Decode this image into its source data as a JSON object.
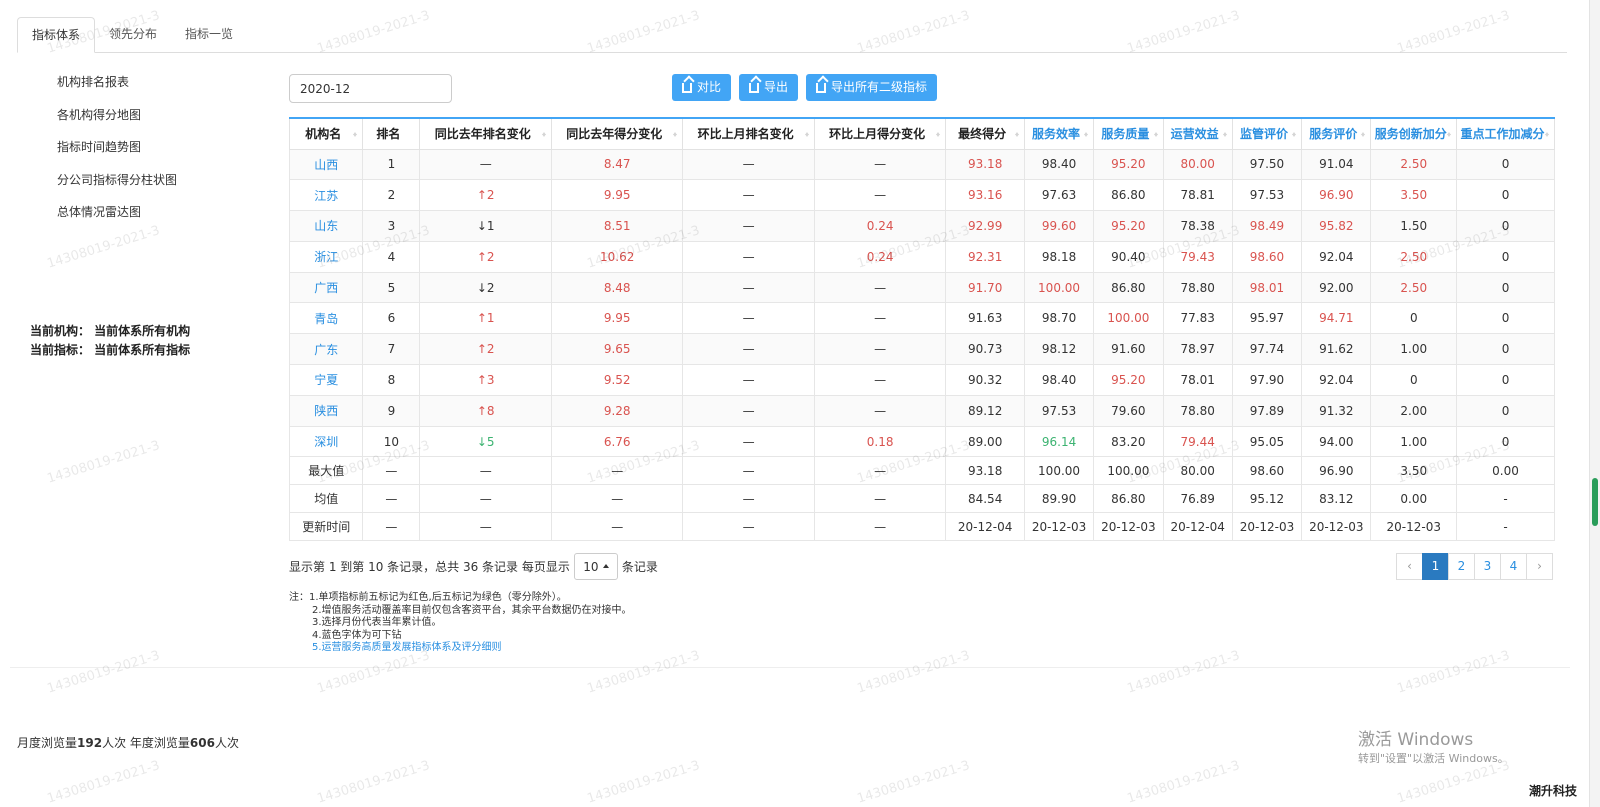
{
  "tabs": [
    {
      "label": "指标体系",
      "active": true
    },
    {
      "label": "领先分布",
      "active": false
    },
    {
      "label": "指标一览",
      "active": false
    }
  ],
  "sidebar": {
    "items": [
      {
        "label": "机构排名报表"
      },
      {
        "label": "各机构得分地图"
      },
      {
        "label": "指标时间趋势图"
      },
      {
        "label": "分公司指标得分柱状图"
      },
      {
        "label": "总体情况雷达图"
      }
    ],
    "current_org": "当前机构： 当前体系所有机构",
    "current_indicator": "当前指标： 当前体系所有指标"
  },
  "filter": {
    "date_value": "2020-12"
  },
  "toolbar": {
    "compare_label": "对比",
    "export_label": "导出",
    "export_all_label": "导出所有二级指标",
    "accent_color": "#42a5f5"
  },
  "table": {
    "columns": [
      "机构名",
      "排名",
      "同比去年排名变化",
      "同比去年得分变化",
      "环比上月排名变化",
      "环比上月得分变化",
      "最终得分",
      "服务效率",
      "服务质量",
      "运营效益",
      "监管评价",
      "服务评价",
      "服务创新加分",
      "重点工作加减分"
    ],
    "rows": [
      {
        "org": "山西",
        "rank": "1",
        "yoy_rank": "—",
        "yoy_score": "8.47",
        "mom_rank": "—",
        "mom_score": "—",
        "final": "93.18",
        "efficiency": "98.40",
        "quality": "95.20",
        "operation": "80.00",
        "regulation": "97.50",
        "service": "91.04",
        "innovation": "2.50",
        "key_work": "0"
      },
      {
        "org": "江苏",
        "rank": "2",
        "yoy_rank": "↑2",
        "yoy_score": "9.95",
        "mom_rank": "—",
        "mom_score": "—",
        "final": "93.16",
        "efficiency": "97.63",
        "quality": "86.80",
        "operation": "78.81",
        "regulation": "97.53",
        "service": "96.90",
        "innovation": "3.50",
        "key_work": "0"
      },
      {
        "org": "山东",
        "rank": "3",
        "yoy_rank": "↓1",
        "yoy_score": "8.51",
        "mom_rank": "—",
        "mom_score": "0.24",
        "final": "92.99",
        "efficiency": "99.60",
        "quality": "95.20",
        "operation": "78.38",
        "regulation": "98.49",
        "service": "95.82",
        "innovation": "1.50",
        "key_work": "0"
      },
      {
        "org": "浙江",
        "rank": "4",
        "yoy_rank": "↑2",
        "yoy_score": "10.62",
        "mom_rank": "—",
        "mom_score": "0.24",
        "final": "92.31",
        "efficiency": "98.18",
        "quality": "90.40",
        "operation": "79.43",
        "regulation": "98.60",
        "service": "92.04",
        "innovation": "2.50",
        "key_work": "0"
      },
      {
        "org": "广西",
        "rank": "5",
        "yoy_rank": "↓2",
        "yoy_score": "8.48",
        "mom_rank": "—",
        "mom_score": "—",
        "final": "91.70",
        "efficiency": "100.00",
        "quality": "86.80",
        "operation": "78.80",
        "regulation": "98.01",
        "service": "92.00",
        "innovation": "2.50",
        "key_work": "0"
      },
      {
        "org": "青岛",
        "rank": "6",
        "yoy_rank": "↑1",
        "yoy_score": "9.95",
        "mom_rank": "—",
        "mom_score": "—",
        "final": "91.63",
        "efficiency": "98.70",
        "quality": "100.00",
        "operation": "77.83",
        "regulation": "95.97",
        "service": "94.71",
        "innovation": "0",
        "key_work": "0"
      },
      {
        "org": "广东",
        "rank": "7",
        "yoy_rank": "↑2",
        "yoy_score": "9.65",
        "mom_rank": "—",
        "mom_score": "—",
        "final": "90.73",
        "efficiency": "98.12",
        "quality": "91.60",
        "operation": "78.97",
        "regulation": "97.74",
        "service": "91.62",
        "innovation": "1.00",
        "key_work": "0"
      },
      {
        "org": "宁夏",
        "rank": "8",
        "yoy_rank": "↑3",
        "yoy_score": "9.52",
        "mom_rank": "—",
        "mom_score": "—",
        "final": "90.32",
        "efficiency": "98.40",
        "quality": "95.20",
        "operation": "78.01",
        "regulation": "97.90",
        "service": "92.04",
        "innovation": "0",
        "key_work": "0"
      },
      {
        "org": "陕西",
        "rank": "9",
        "yoy_rank": "↑8",
        "yoy_score": "9.28",
        "mom_rank": "—",
        "mom_score": "—",
        "final": "89.12",
        "efficiency": "97.53",
        "quality": "79.60",
        "operation": "78.80",
        "regulation": "97.89",
        "service": "91.32",
        "innovation": "2.00",
        "key_work": "0"
      },
      {
        "org": "深圳",
        "rank": "10",
        "yoy_rank": "↓5",
        "yoy_score": "6.76",
        "mom_rank": "—",
        "mom_score": "0.18",
        "final": "89.00",
        "efficiency": "96.14",
        "quality": "83.20",
        "operation": "79.44",
        "regulation": "95.05",
        "service": "94.00",
        "innovation": "1.00",
        "key_work": "0"
      }
    ],
    "summary_rows": [
      {
        "label": "最大值",
        "cells": [
          "—",
          "—",
          "—",
          "—",
          "—",
          "93.18",
          "100.00",
          "100.00",
          "80.00",
          "98.60",
          "96.90",
          "3.50",
          "0.00"
        ]
      },
      {
        "label": "均值",
        "cells": [
          "—",
          "—",
          "—",
          "—",
          "—",
          "84.54",
          "89.90",
          "86.80",
          "76.89",
          "95.12",
          "83.12",
          "0.00",
          "-"
        ]
      },
      {
        "label": "更新时间",
        "cells": [
          "—",
          "—",
          "—",
          "—",
          "—",
          "20-12-04",
          "20-12-03",
          "20-12-03",
          "20-12-04",
          "20-12-03",
          "20-12-03",
          "20-12-03",
          "-"
        ]
      }
    ],
    "highlight_colors": {
      "top_five": "#d9534f",
      "bottom_five": "#3cb371",
      "drilldown": "#2a8fe0"
    }
  },
  "pager": {
    "info_prefix": "显示第 1 到第 10 条记录，总共 36 条记录  每页显示",
    "page_size": "10",
    "info_suffix": "条记录",
    "prev": "‹",
    "pages": [
      "1",
      "2",
      "3",
      "4"
    ],
    "next": "›",
    "current_page": "1"
  },
  "notes": {
    "first": "注：1.单项指标前五标记为红色,后五标记为绿色（零分除外）。",
    "items": [
      "2.增值服务活动覆盖率目前仅包含客资平台，其余平台数据仍在对接中。",
      "3.选择月份代表当年累计值。",
      "4.蓝色字体为可下钻"
    ],
    "link": "5.运营服务高质量发展指标体系及评分细则"
  },
  "footer": {
    "monthly_prefix": "月度浏览量",
    "monthly_count": "192",
    "monthly_suffix": "人次 年度浏览量",
    "yearly_count": "606",
    "yearly_suffix": "人次"
  },
  "activation": {
    "title": "激活 Windows",
    "subtitle": "转到\"设置\"以激活 Windows。"
  },
  "brand": "潮升科技",
  "watermark": "14308019-2021-3"
}
